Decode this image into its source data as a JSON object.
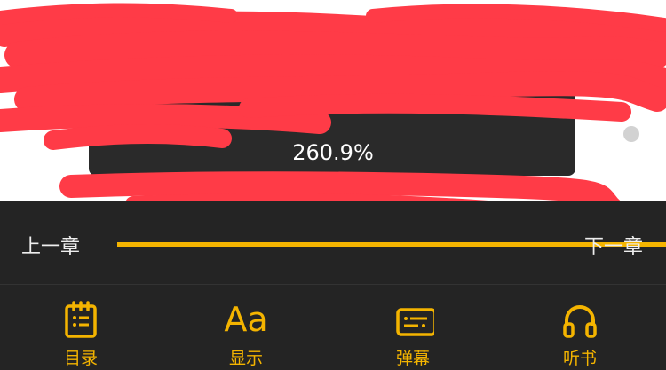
{
  "reader": {
    "progress_text": "260.9%"
  },
  "toolbar": {
    "prev_chapter_label": "上一章",
    "next_chapter_label": "下一章",
    "accent_color": "#f4b400",
    "background_color": "#242424"
  },
  "nav": {
    "items": [
      {
        "label": "目录",
        "icon": "catalog-icon"
      },
      {
        "label": "显示",
        "icon": "font-size-icon",
        "glyph": "Aa"
      },
      {
        "label": "弹幕",
        "icon": "danmaku-icon"
      },
      {
        "label": "听书",
        "icon": "headphones-icon"
      }
    ]
  }
}
